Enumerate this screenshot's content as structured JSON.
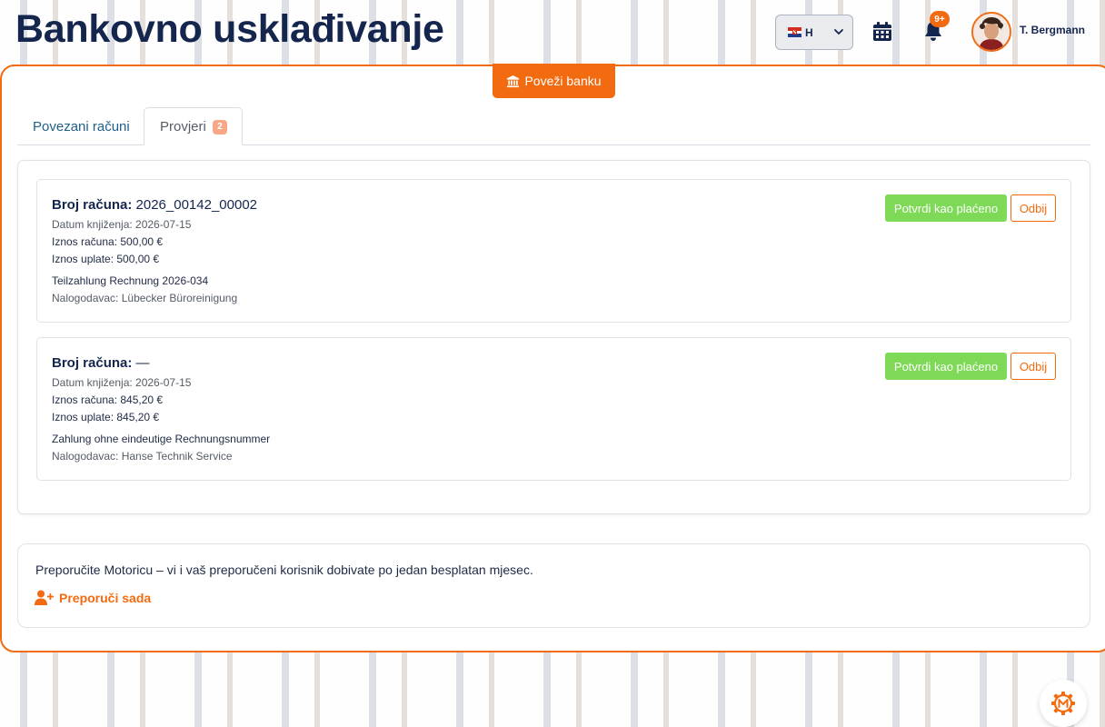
{
  "header": {
    "title": "Bankovno usklađivanje",
    "language_code": "H",
    "notification_badge": "9+",
    "user_name": "T. Bergmann"
  },
  "connect_bank_label": "Poveži banku",
  "tabs": [
    {
      "label": "Povezani računi",
      "active": false
    },
    {
      "label": "Provjeri",
      "count": "2",
      "active": true
    }
  ],
  "items": [
    {
      "invoice_label": "Broj računa:",
      "invoice_value": "2026_00142_00002",
      "booking_date": "Datum knjiženja: 2026-07-15",
      "invoice_amount": "Iznos računa: 500,00 €",
      "payment_amount": "Iznos uplate: 500,00 €",
      "reference": "Teilzahlung Rechnung 2026-034",
      "payer": "Nalogodavac: Lübecker Büroreinigung",
      "confirm_label": "Potvrdi kao plaćeno",
      "reject_label": "Odbij"
    },
    {
      "invoice_label": "Broj računa:",
      "invoice_value": "—",
      "booking_date": "Datum knjiženja: 2026-07-15",
      "invoice_amount": "Iznos računa: 845,20 €",
      "payment_amount": "Iznos uplate: 845,20 €",
      "reference": "Zahlung ohne eindeutige Rechnungsnummer",
      "payer": "Nalogodavac: Hanse Technik Service",
      "confirm_label": "Potvrdi kao plaćeno",
      "reject_label": "Odbij"
    }
  ],
  "referral": {
    "text": "Preporučite Motoricu – vi i vaš preporučeni korisnik dobivate po jedan besplatan mjesec.",
    "link_label": "Preporuči sada"
  },
  "colors": {
    "accent": "#f36b10",
    "confirm": "#7ed957",
    "title": "#14264d",
    "tab_link": "#1f5f8b"
  },
  "icons": {
    "language_flag": "croatia-flag-icon",
    "calendar": "calendar-icon",
    "notifications": "bell-icon",
    "connect_bank": "bank-icon",
    "referral": "user-plus-icon",
    "support": "motorica-logo-icon"
  }
}
